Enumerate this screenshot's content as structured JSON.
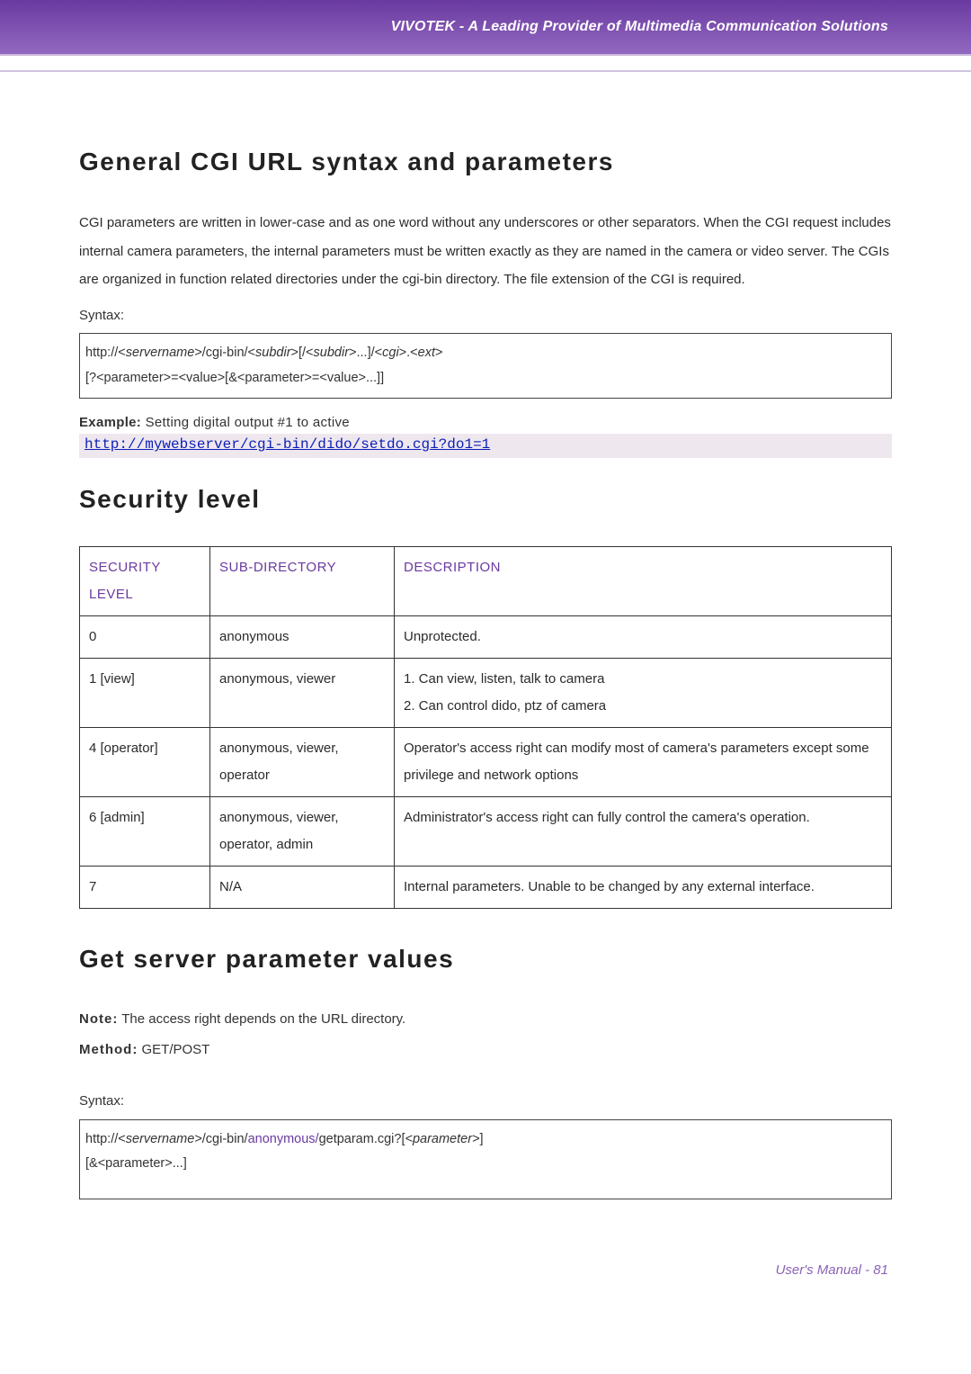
{
  "header": {
    "tagline": "VIVOTEK - A Leading Provider of Multimedia Communication Solutions"
  },
  "section1": {
    "title": "General CGI URL syntax and parameters",
    "body": "CGI parameters are written in lower-case and as one word without any underscores or other separators. When the CGI request includes internal camera parameters, the internal parameters must be written exactly as they are named in the camera or video server. The CGIs are organized in function related directories under the cgi-bin directory. The file extension of the CGI is required.",
    "syntax_label": "Syntax:",
    "syntax_line1_pre": "http://<",
    "syntax_line1_srv": "servername",
    "syntax_line1_mid1": ">/cgi-bin/<",
    "syntax_line1_sub1": "subdir",
    "syntax_line1_mid2": ">[/<",
    "syntax_line1_sub2": "subdir",
    "syntax_line1_mid3": ">...]/<",
    "syntax_line1_cgi": "cgi",
    "syntax_line1_mid4": ">.<",
    "syntax_line1_ext": "ext",
    "syntax_line1_end": ">",
    "syntax_line2": "[?<parameter>=<value>[&<parameter>=<value>...]]",
    "example_bold": "Example:",
    "example_rest": " Setting digital output #1 to active",
    "example_link": "http://mywebserver/cgi-bin/dido/setdo.cgi?do1=1"
  },
  "section2": {
    "title": "Security level",
    "headers": [
      "SECURITY LEVEL",
      "SUB-DIRECTORY",
      "DESCRIPTION"
    ],
    "rows": [
      {
        "level": "0",
        "subdir": "anonymous",
        "desc": "Unprotected."
      },
      {
        "level": "1 [view]",
        "subdir": "anonymous, viewer",
        "desc": "1. Can view, listen, talk to camera\n2. Can control dido, ptz of camera"
      },
      {
        "level": "4 [operator]",
        "subdir": "anonymous, viewer, operator",
        "desc": "Operator's access right can modify most of camera's parameters except some privilege and network options"
      },
      {
        "level": "6 [admin]",
        "subdir": "anonymous, viewer, operator, admin",
        "desc": "Administrator's access right can fully control the camera's operation."
      },
      {
        "level": "7",
        "subdir": "N/A",
        "desc": "Internal parameters. Unable to be changed by any external interface."
      }
    ]
  },
  "section3": {
    "title": "Get server parameter values",
    "note_bold": "Note:",
    "note_rest": " The access right depends on the URL directory.",
    "method_bold": "Method:",
    "method_rest": " GET/POST",
    "syntax_label": "Syntax:",
    "line1_a": "http://<",
    "line1_srv": "servername",
    "line1_b": ">/cgi-bin/",
    "line1_anon": "anonymous/",
    "line1_c": "getparam.cgi?[",
    "line1_param": "<parameter>",
    "line1_d": "]",
    "line2": "[&<parameter>...]"
  },
  "footer": {
    "text": "User's Manual - 81"
  }
}
